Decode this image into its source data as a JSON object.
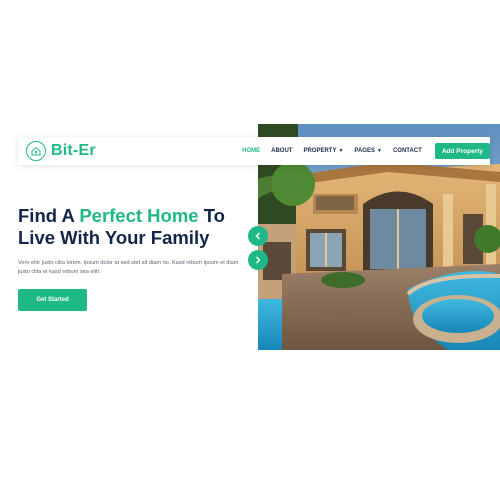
{
  "brand": {
    "name": "Bit-Er",
    "logo_icon": "house-leaf-icon"
  },
  "nav": {
    "items": [
      {
        "label": "HOME",
        "active": true,
        "dropdown": false
      },
      {
        "label": "ABOUT",
        "active": false,
        "dropdown": false
      },
      {
        "label": "PROPERTY",
        "active": false,
        "dropdown": true
      },
      {
        "label": "PAGES",
        "active": false,
        "dropdown": true
      },
      {
        "label": "CONTACT",
        "active": false,
        "dropdown": false
      }
    ],
    "cta_label": "Add Property"
  },
  "hero": {
    "headline_part1": "Find A ",
    "headline_highlight": "Perfect Home",
    "headline_part2": " To",
    "headline_line2": "Live With Your Family",
    "subtext": "Vero elitr justo clita lorem. Ipsum dolor at sed stet sit diam no. Kasd rebum ipsum et diam justo clita et kasd rebum sea elitr.",
    "button_label": "Get Started",
    "image_alt": "house-with-pool-photo"
  },
  "slider": {
    "prev_icon": "chevron-left-icon",
    "next_icon": "chevron-right-icon"
  },
  "colors": {
    "accent": "#1fb987",
    "heading": "#13264a",
    "body": "#5e6574"
  }
}
